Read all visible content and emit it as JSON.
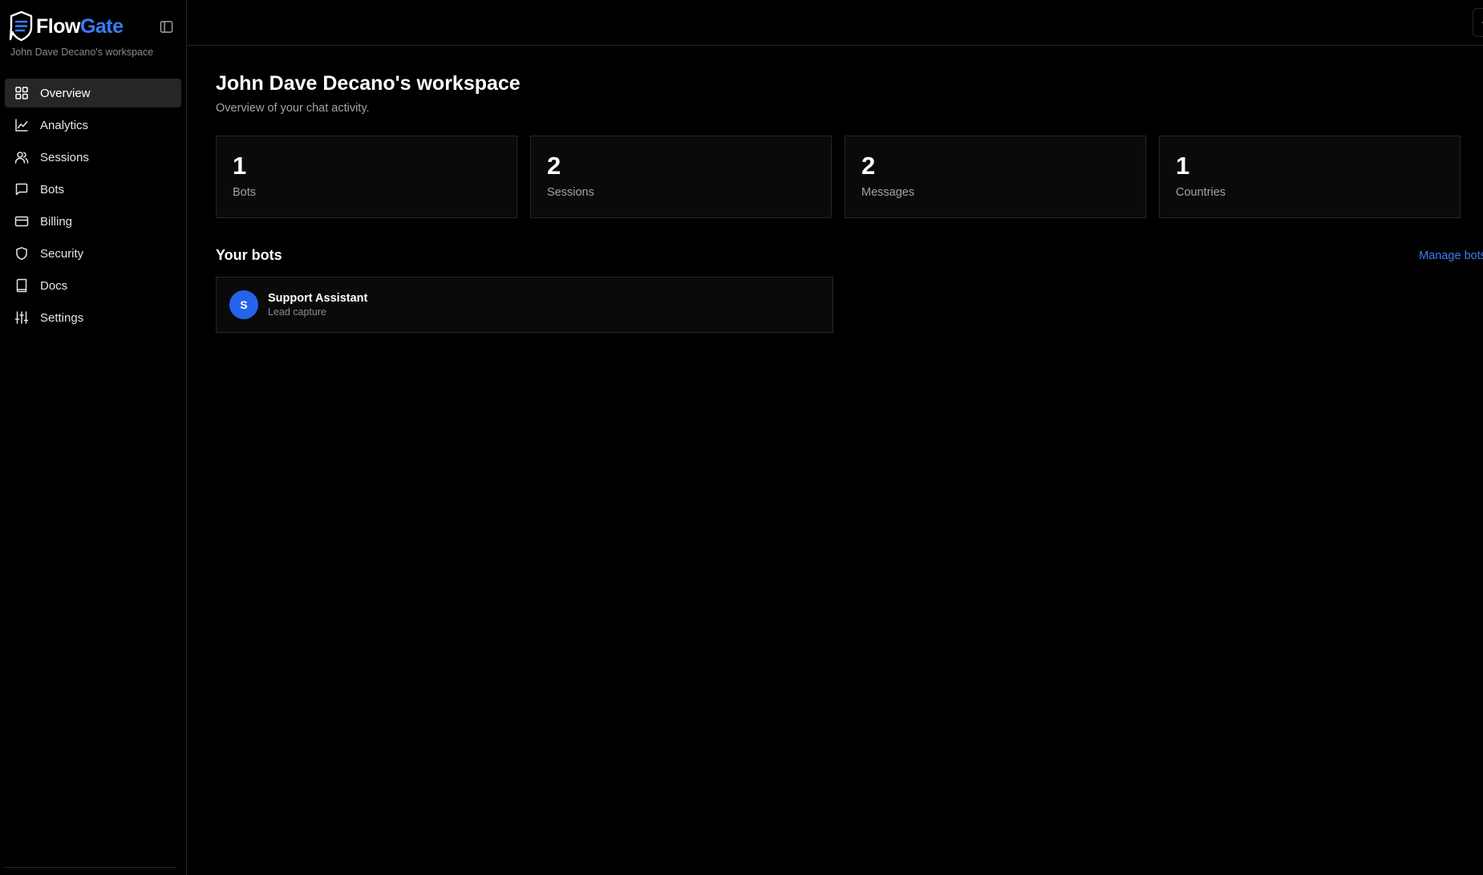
{
  "brand": {
    "name_part1": "Flow",
    "name_part2": "Gate",
    "accent_color": "#3b7df5",
    "logo_icon": "chat-shield-logo"
  },
  "sidebar": {
    "workspace_name": "John Dave Decano's workspace",
    "collapse_icon": "sidebar-toggle-icon",
    "items": [
      {
        "label": "Overview",
        "icon": "grid-icon",
        "active": true
      },
      {
        "label": "Analytics",
        "icon": "line-chart-icon",
        "active": false
      },
      {
        "label": "Sessions",
        "icon": "users-icon",
        "active": false
      },
      {
        "label": "Bots",
        "icon": "message-square-icon",
        "active": false
      },
      {
        "label": "Billing",
        "icon": "credit-card-icon",
        "active": false
      },
      {
        "label": "Security",
        "icon": "shield-icon",
        "active": false
      },
      {
        "label": "Docs",
        "icon": "book-icon",
        "active": false
      },
      {
        "label": "Settings",
        "icon": "sliders-icon",
        "active": false
      }
    ]
  },
  "topbar": {
    "theme_toggle_icon": "sun-icon"
  },
  "main": {
    "title": "John Dave Decano's workspace",
    "subtitle": "Overview of your chat activity.",
    "stats": [
      {
        "value": "1",
        "label": "Bots"
      },
      {
        "value": "2",
        "label": "Sessions"
      },
      {
        "value": "2",
        "label": "Messages"
      },
      {
        "value": "1",
        "label": "Countries"
      }
    ],
    "bots_section": {
      "title": "Your bots",
      "manage_link": "Manage bots",
      "bots": [
        {
          "initial": "S",
          "name": "Support Assistant",
          "type": "Lead capture",
          "avatar_color": "#2563eb"
        }
      ]
    }
  }
}
